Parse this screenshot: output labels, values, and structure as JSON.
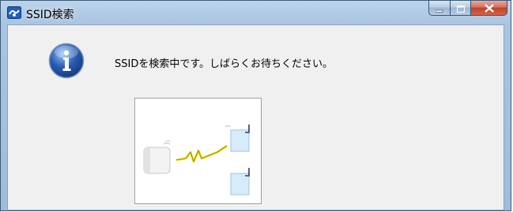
{
  "window": {
    "title": "SSID検索",
    "icon": "network-search-icon",
    "controls": [
      "minimize-icon",
      "maximize-icon",
      "close-icon"
    ]
  },
  "dialog": {
    "icon": "info-icon",
    "message": "SSIDを検索中です。しばらくお待ちください。",
    "animation": {
      "items": [
        "router-icon",
        "wireless-signal-icon",
        "access-point-icon",
        "access-point-icon"
      ]
    }
  },
  "colors": {
    "titlebar": "#a9c4e0",
    "client_bg": "#f0f0f0",
    "close_button": "#c0432b",
    "info_icon": "#2a5db0",
    "signal": "#e8d800"
  }
}
